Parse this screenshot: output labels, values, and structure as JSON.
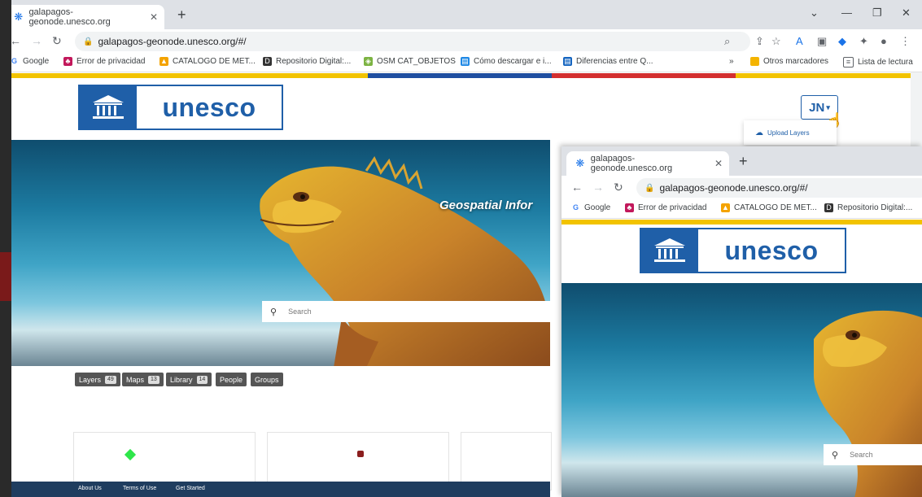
{
  "main_browser": {
    "tab_title": "galapagos-geonode.unesco.org",
    "url": "galapagos-geonode.unesco.org/#/",
    "bookmarks": [
      {
        "label": "Google",
        "color": "#4285f4"
      },
      {
        "label": "Error de privacidad",
        "color": "#c2185b"
      },
      {
        "label": "CATALOGO DE MET...",
        "color": "#f4a300"
      },
      {
        "label": "Repositorio Digital:...",
        "color": "#333333"
      },
      {
        "label": "OSM CAT_OBJETOS",
        "color": "#7cb342"
      },
      {
        "label": "Cómo descargar e i...",
        "color": "#1e88e5"
      },
      {
        "label": "Diferencias entre Q...",
        "color": "#1565c0"
      }
    ],
    "bookmarks_more": "»",
    "other_bookmarks": "Otros marcadores",
    "reading_list": "Lista de lectura"
  },
  "site": {
    "logo_text": "unesco",
    "user_button": "JN",
    "dropdown_item": "Upload Layers",
    "hero_title": "Geospatial Infor",
    "search_placeholder": "Search",
    "nav_pills": [
      {
        "label": "Layers",
        "count": "49"
      },
      {
        "label": "Maps",
        "count": "13"
      },
      {
        "label": "Library",
        "count": "14"
      },
      {
        "label": "People",
        "count": ""
      },
      {
        "label": "Groups",
        "count": ""
      }
    ],
    "footer_links": [
      "About Us",
      "Terms of Use",
      "Get Started"
    ]
  },
  "overlay_browser": {
    "tab_title": "galapagos-geonode.unesco.org",
    "url": "galapagos-geonode.unesco.org/#/",
    "bookmarks": [
      {
        "label": "Google",
        "color": "#4285f4"
      },
      {
        "label": "Error de privacidad",
        "color": "#c2185b"
      },
      {
        "label": "CATALOGO DE MET...",
        "color": "#f4a300"
      },
      {
        "label": "Repositorio Digital:...",
        "color": "#333333"
      }
    ],
    "logo_text": "unesco",
    "search_placeholder": "Search"
  },
  "colors": {
    "unesco_blue": "#1f5fa8",
    "stripe_yellow": "#f2c300",
    "stripe_blue": "#1f4fa0",
    "stripe_red": "#d32f2f",
    "footer": "#1f3d5f"
  }
}
